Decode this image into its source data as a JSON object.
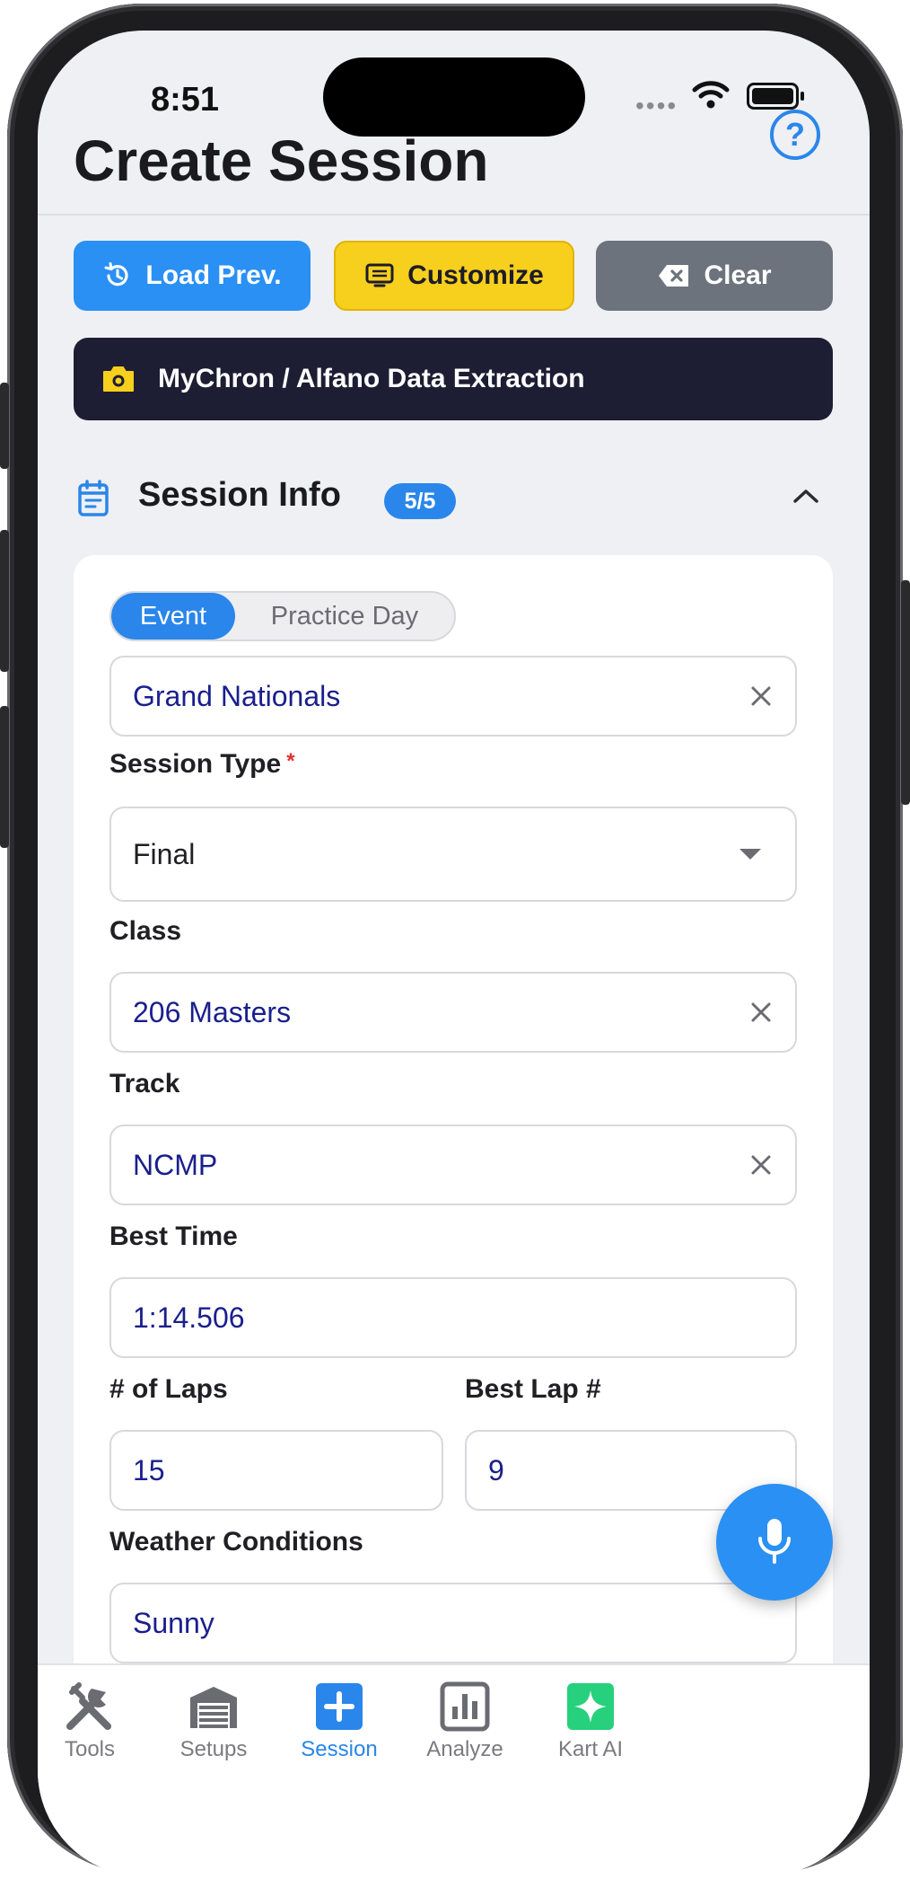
{
  "status": {
    "time": "8:51",
    "signal_dots": "••••"
  },
  "header": {
    "title": "Create Session"
  },
  "actions": {
    "load_prev": "Load Prev.",
    "customize": "Customize",
    "clear": "Clear",
    "extraction": "MyChron / Alfano Data Extraction"
  },
  "section": {
    "title": "Session Info",
    "badge": "5/5"
  },
  "form": {
    "mode_tabs": [
      "Event",
      "Practice Day"
    ],
    "selected_mode": "Event",
    "event_name": "Grand Nationals",
    "session_type": {
      "label": "Session Type",
      "required_mark": "*",
      "value": "Final"
    },
    "class": {
      "label": "Class",
      "value": "206 Masters"
    },
    "track": {
      "label": "Track",
      "value": "NCMP"
    },
    "best_time": {
      "label": "Best Time",
      "value": "1:14.506"
    },
    "laps": {
      "label": "# of Laps",
      "value": "15"
    },
    "best_lap": {
      "label": "Best Lap #",
      "value": "9"
    },
    "weather": {
      "label": "Weather Conditions",
      "value": "Sunny"
    }
  },
  "tabs": [
    {
      "label": "Tools",
      "icon": "tools-icon"
    },
    {
      "label": "Setups",
      "icon": "garage-icon"
    },
    {
      "label": "Session",
      "icon": "plus-square-icon"
    },
    {
      "label": "Analyze",
      "icon": "bar-chart-icon"
    },
    {
      "label": "Kart AI",
      "icon": "sparkle-icon"
    }
  ],
  "colors": {
    "accent": "#2a86ea",
    "customize_yellow": "#f7cf1d",
    "clear_gray": "#6c737d",
    "extraction_dark": "#1d1e33",
    "kart_ai_green": "#26d07c",
    "input_text": "#1a1f8c"
  }
}
